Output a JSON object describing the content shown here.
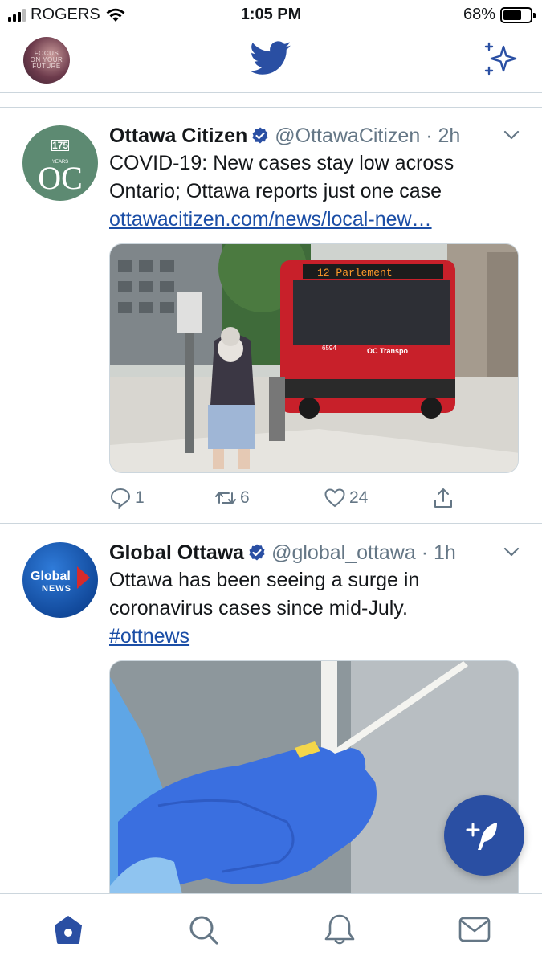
{
  "status_bar": {
    "carrier": "ROGERS",
    "time": "1:05 PM",
    "battery_percent": "68%",
    "battery_level": 0.68
  },
  "top_bar": {
    "avatar_text": [
      "FOCUS",
      "ON YOUR",
      "FUTURE"
    ],
    "logo_icon": "twitter-bird-icon",
    "right_icon": "sparkle-icon"
  },
  "tweets": [
    {
      "name": "Ottawa Citizen",
      "handle": "@OttawaCitizen",
      "separator": "·",
      "time": "2h",
      "text": "COVID-19: New cases stay low across Ontario; Ottawa reports just one case",
      "link": "ottawacitizen.com/news/local-new…",
      "avatar_top": "175",
      "avatar_years": "YEARS",
      "avatar_letters": "OC",
      "media_sign": "12  Parlement",
      "media_bus_number": "6594",
      "media_bus_brand": "OC Transpo",
      "replies": "1",
      "retweets": "6",
      "likes": "24"
    },
    {
      "name": "Global Ottawa",
      "handle": "@global_ottawa",
      "separator": "·",
      "time": "1h",
      "text": "Ottawa has been seeing a surge in coronavirus cases since mid-July.",
      "link": "#ottnews",
      "avatar_brand": "Global",
      "avatar_news": "NEWS"
    }
  ],
  "colors": {
    "accent": "#2a4fa3",
    "link": "#1b4ea6",
    "muted": "#657786",
    "divider": "#ccd6dd"
  },
  "bottom_nav": [
    "home-icon",
    "search-icon",
    "notifications-icon",
    "messages-icon"
  ]
}
